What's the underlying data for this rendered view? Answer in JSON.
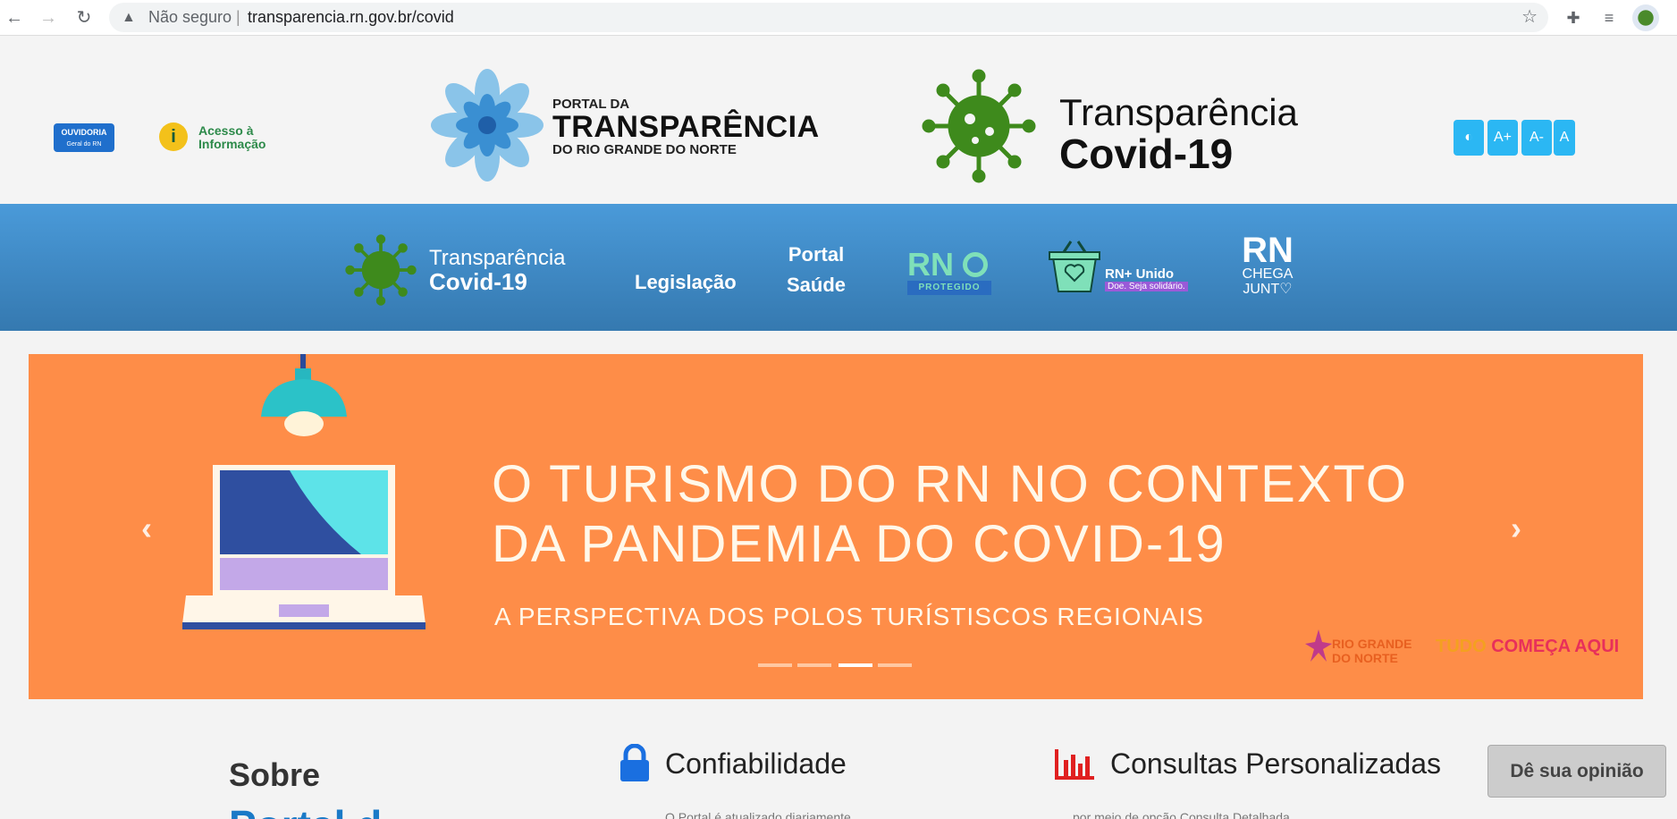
{
  "browser": {
    "back_icon": "arrow-left-icon",
    "forward_icon": "arrow-right-icon",
    "reload_icon": "reload-icon",
    "security_label": "Não seguro",
    "url": "transparencia.rn.gov.br/covid"
  },
  "header": {
    "ouvidoria_label": "OUVIDORIA",
    "ouvidoria_sub": "Geral do RN",
    "acesso_line1": "Acesso à",
    "acesso_line2": "Informação",
    "portal_small": "PORTAL DA",
    "portal_big": "TRANSPARÊNCIA",
    "portal_sub": "DO RIO GRANDE DO NORTE",
    "covid_line1": "Transparência",
    "covid_line2": "Covid-19",
    "a11y": {
      "contrast": "◐",
      "increase": "A+",
      "decrease": "A-",
      "reset": "A"
    }
  },
  "nav": {
    "covid_line1": "Transparência",
    "covid_line2": "Covid-19",
    "legislacao": "Legislação",
    "portal_line1": "Portal",
    "portal_line2": "Saúde",
    "rn_protegido_big": "RN",
    "rn_protegido_label": "PROTEGIDO",
    "rn_unido": "RN+ Unido",
    "rn_unido_sub": "Doe. Seja solidário.",
    "rn_chega_big": "RN",
    "rn_chega_line1": "CHEGA",
    "rn_chega_line2": "JUNT♡"
  },
  "banner": {
    "headline_line1": "O TURISMO DO RN NO CONTEXTO",
    "headline_line2": "DA PANDEMIA DO COVID-19",
    "subline": "A PERSPECTIVA DOS POLOS TURÍSTISCOS REGIONAIS",
    "logo_text": "RIO GRANDE DO NORTE",
    "slogan_pre": "TUDO",
    "slogan_main": "COMEÇA AQUI",
    "active_slide": 3,
    "slide_count": 4,
    "colors": {
      "background": "#fe8d48",
      "text": "#fff8ea"
    }
  },
  "content": {
    "sobre_title": "Sobre",
    "sobre_title2": "Portal d",
    "confiabilidade": "Confiabilidade",
    "confiabilidade_snippet": "O Portal é atualizado diariamente",
    "consultas": "Consultas Personalizadas",
    "consultas_snippet": "por meio de opção Consulta Detalhada"
  },
  "feedback_button": "Dê sua opinião",
  "colors": {
    "nav_blue": "#3f8ccb",
    "accent_cyan": "#2bb7f3",
    "virus_green": "#3e8a1c"
  }
}
